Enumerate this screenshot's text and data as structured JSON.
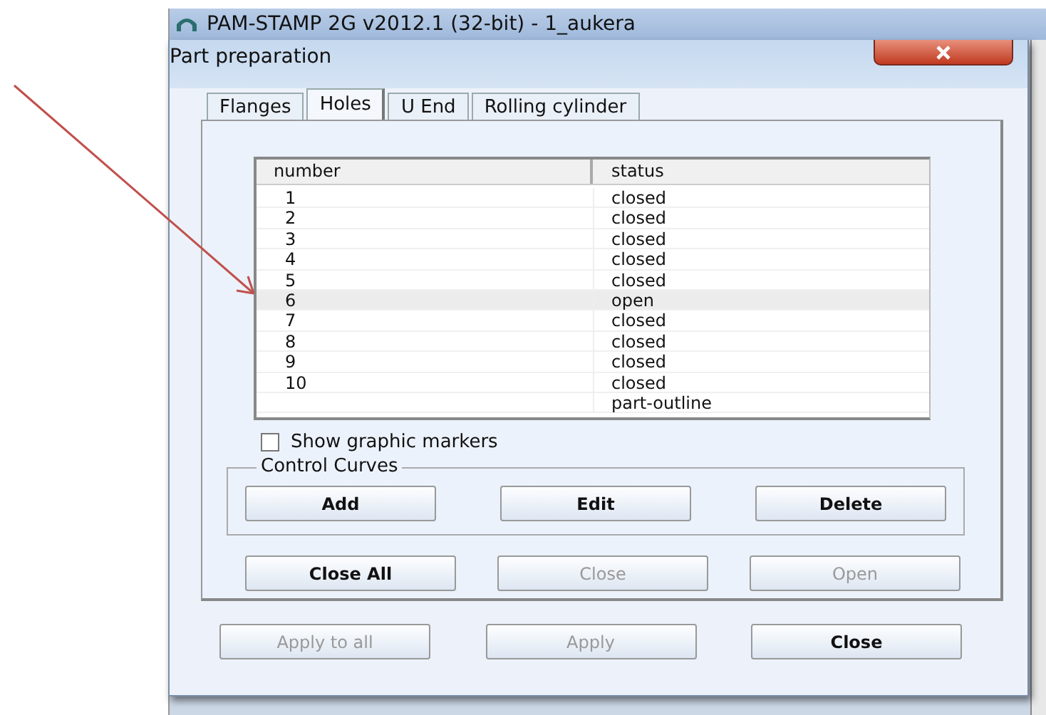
{
  "app_window": {
    "title": "PAM-STAMP 2G v2012.1 (32-bit) - 1_aukera"
  },
  "dialog": {
    "title": "Part preparation"
  },
  "tabs": [
    {
      "label": "Flanges",
      "selected": false
    },
    {
      "label": "Holes",
      "selected": true
    },
    {
      "label": "U End",
      "selected": false
    },
    {
      "label": "Rolling cylinder",
      "selected": false
    }
  ],
  "table": {
    "columns": [
      "number",
      "status"
    ],
    "rows": [
      {
        "number": "1",
        "status": "closed",
        "selected": false
      },
      {
        "number": "2",
        "status": "closed",
        "selected": false
      },
      {
        "number": "3",
        "status": "closed",
        "selected": false
      },
      {
        "number": "4",
        "status": "closed",
        "selected": false
      },
      {
        "number": "5",
        "status": "closed",
        "selected": false
      },
      {
        "number": "6",
        "status": "open",
        "selected": true
      },
      {
        "number": "7",
        "status": "closed",
        "selected": false
      },
      {
        "number": "8",
        "status": "closed",
        "selected": false
      },
      {
        "number": "9",
        "status": "closed",
        "selected": false
      },
      {
        "number": "10",
        "status": "closed",
        "selected": false
      },
      {
        "number": "",
        "status": "part-outline",
        "selected": false
      }
    ]
  },
  "show_markers": {
    "label": "Show graphic markers",
    "checked": false
  },
  "control_curves": {
    "title": "Control Curves",
    "buttons": [
      {
        "label": "Add",
        "disabled": false
      },
      {
        "label": "Edit",
        "disabled": false
      },
      {
        "label": "Delete",
        "disabled": false
      }
    ]
  },
  "hole_buttons": [
    {
      "label": "Close All",
      "disabled": false
    },
    {
      "label": "Close",
      "disabled": true
    },
    {
      "label": "Open",
      "disabled": true
    }
  ],
  "footer_buttons": [
    {
      "label": "Apply to all",
      "disabled": true
    },
    {
      "label": "Apply",
      "disabled": true
    },
    {
      "label": "Close",
      "disabled": false
    }
  ]
}
